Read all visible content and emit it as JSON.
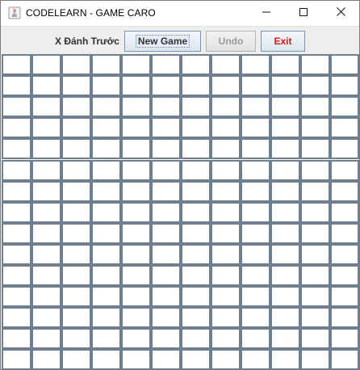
{
  "window": {
    "title": "CODELEARN - GAME CARO",
    "controls": [
      "minimize-icon",
      "maximize-icon",
      "close-icon"
    ]
  },
  "toolbar": {
    "turn_label": "X Đánh Trước",
    "new_game_label": "New Game",
    "undo_label": "Undo",
    "exit_label": "Exit",
    "undo_enabled": false
  },
  "board": {
    "columns": 12,
    "rows": 15,
    "cells": []
  },
  "colors": {
    "exit_text": "#e01010",
    "grid_line": "#6f7f8f",
    "toolbar_bg": "#eeeeee",
    "disabled_text": "#9a9a9a"
  }
}
